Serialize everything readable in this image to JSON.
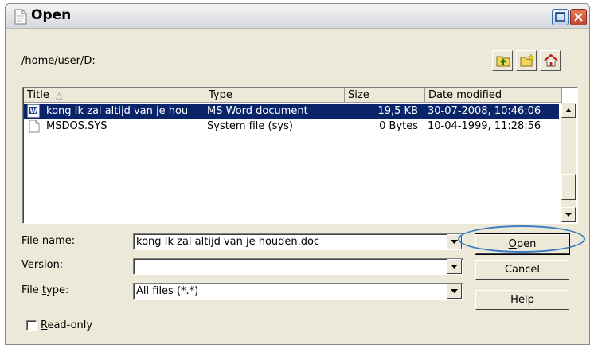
{
  "window": {
    "title": "Open"
  },
  "path": "/home/user/D:",
  "toolbar_icons": [
    "folder-up-icon",
    "new-folder-icon",
    "home-icon"
  ],
  "columns": {
    "title": "Title",
    "sort_indicator": "△",
    "type": "Type",
    "size": "Size",
    "date": "Date modified"
  },
  "files": [
    {
      "name": "kong Ik zal altijd van je hou",
      "type": "MS Word document",
      "size": "19,5 KB",
      "date": "30-07-2008, 10:46:06",
      "selected": true,
      "icon": "word-document-icon"
    },
    {
      "name": "MSDOS.SYS",
      "type": "System file (sys)",
      "size": "0 Bytes",
      "date": "10-04-1999, 11:28:56",
      "selected": false,
      "icon": "file-icon"
    }
  ],
  "form": {
    "file_name": {
      "label_pre": "File ",
      "label_key": "n",
      "label_post": "ame:",
      "value": "kong Ik zal altijd van je houden.doc"
    },
    "version": {
      "label_pre": "",
      "label_key": "V",
      "label_post": "ersion:",
      "value": ""
    },
    "file_type": {
      "label_pre": "File ",
      "label_key": "t",
      "label_post": "ype:",
      "value": "All files (*.*)"
    }
  },
  "buttons": {
    "open": {
      "key": "O",
      "rest": "pen"
    },
    "cancel": "Cancel",
    "help": {
      "key": "H",
      "rest": "elp"
    }
  },
  "read_only": {
    "key": "R",
    "rest": "ead-only",
    "checked": false
  },
  "colors": {
    "selection": "#0a246a",
    "focus_ring": "#3d7bc0",
    "dialog_bg": "#ece9d8"
  }
}
